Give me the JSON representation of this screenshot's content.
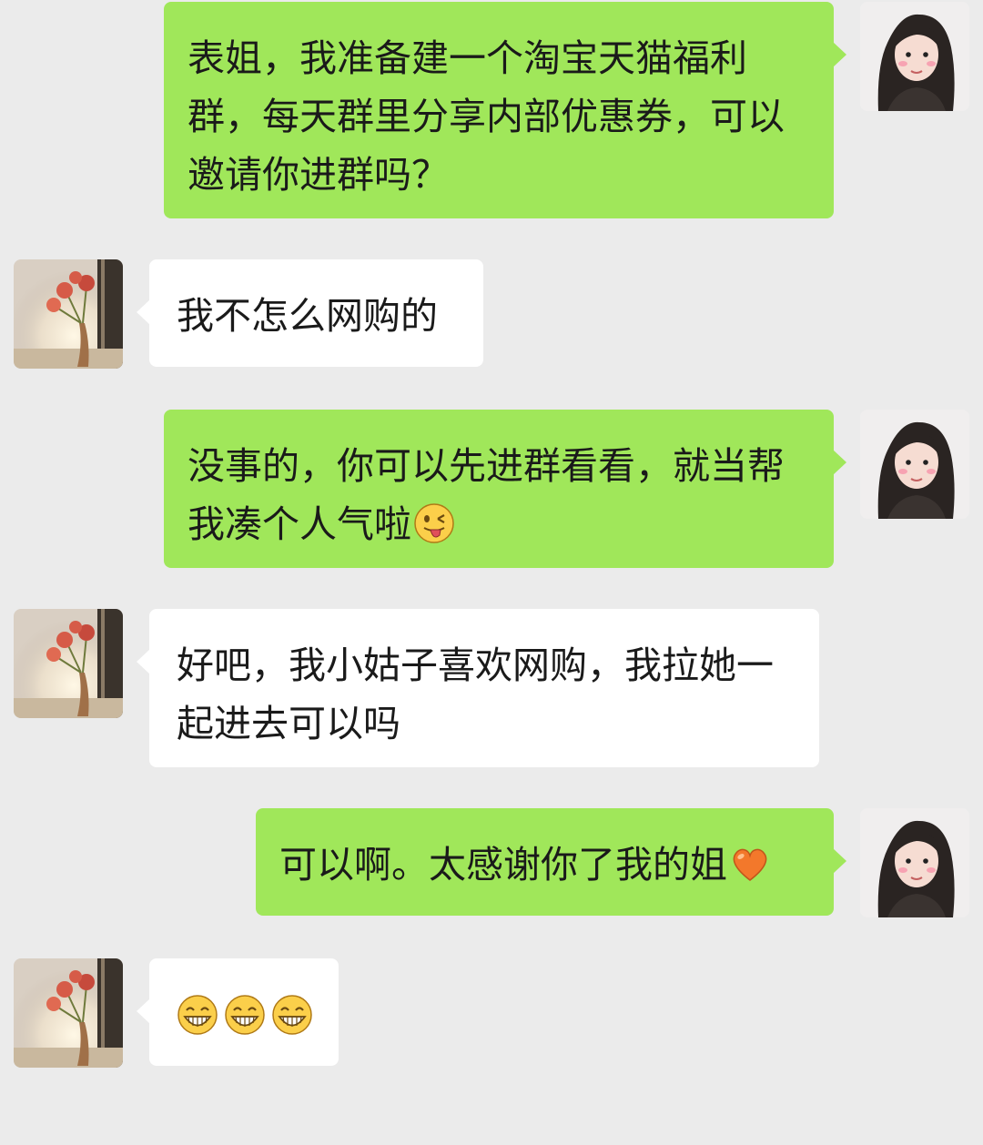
{
  "messages": [
    {
      "side": "out",
      "text": "表姐，我准备建一个淘宝天猫福利群，每天群里分享内部优惠券，可以邀请你进群吗？"
    },
    {
      "side": "in",
      "text": "我不怎么网购的"
    },
    {
      "side": "out",
      "text": "没事的，你可以先进群看看，就当帮我凑个人气啦",
      "emoji": "wink-tongue-emoji"
    },
    {
      "side": "in",
      "text": "好吧，我小姑子喜欢网购，我拉她一起进去可以吗"
    },
    {
      "side": "out",
      "text": "可以啊。太感谢你了我的姐",
      "emoji": "orange-heart-emoji"
    },
    {
      "side": "in",
      "text": "",
      "emojis": [
        "grin-emoji",
        "grin-emoji",
        "grin-emoji"
      ]
    }
  ],
  "colors": {
    "background": "#ebebeb",
    "outgoing_bubble": "#a0e75a",
    "incoming_bubble": "#ffffff",
    "text": "#1a1a1a"
  },
  "avatars": {
    "me": "girl-portrait-avatar",
    "contact": "flower-vase-avatar"
  }
}
